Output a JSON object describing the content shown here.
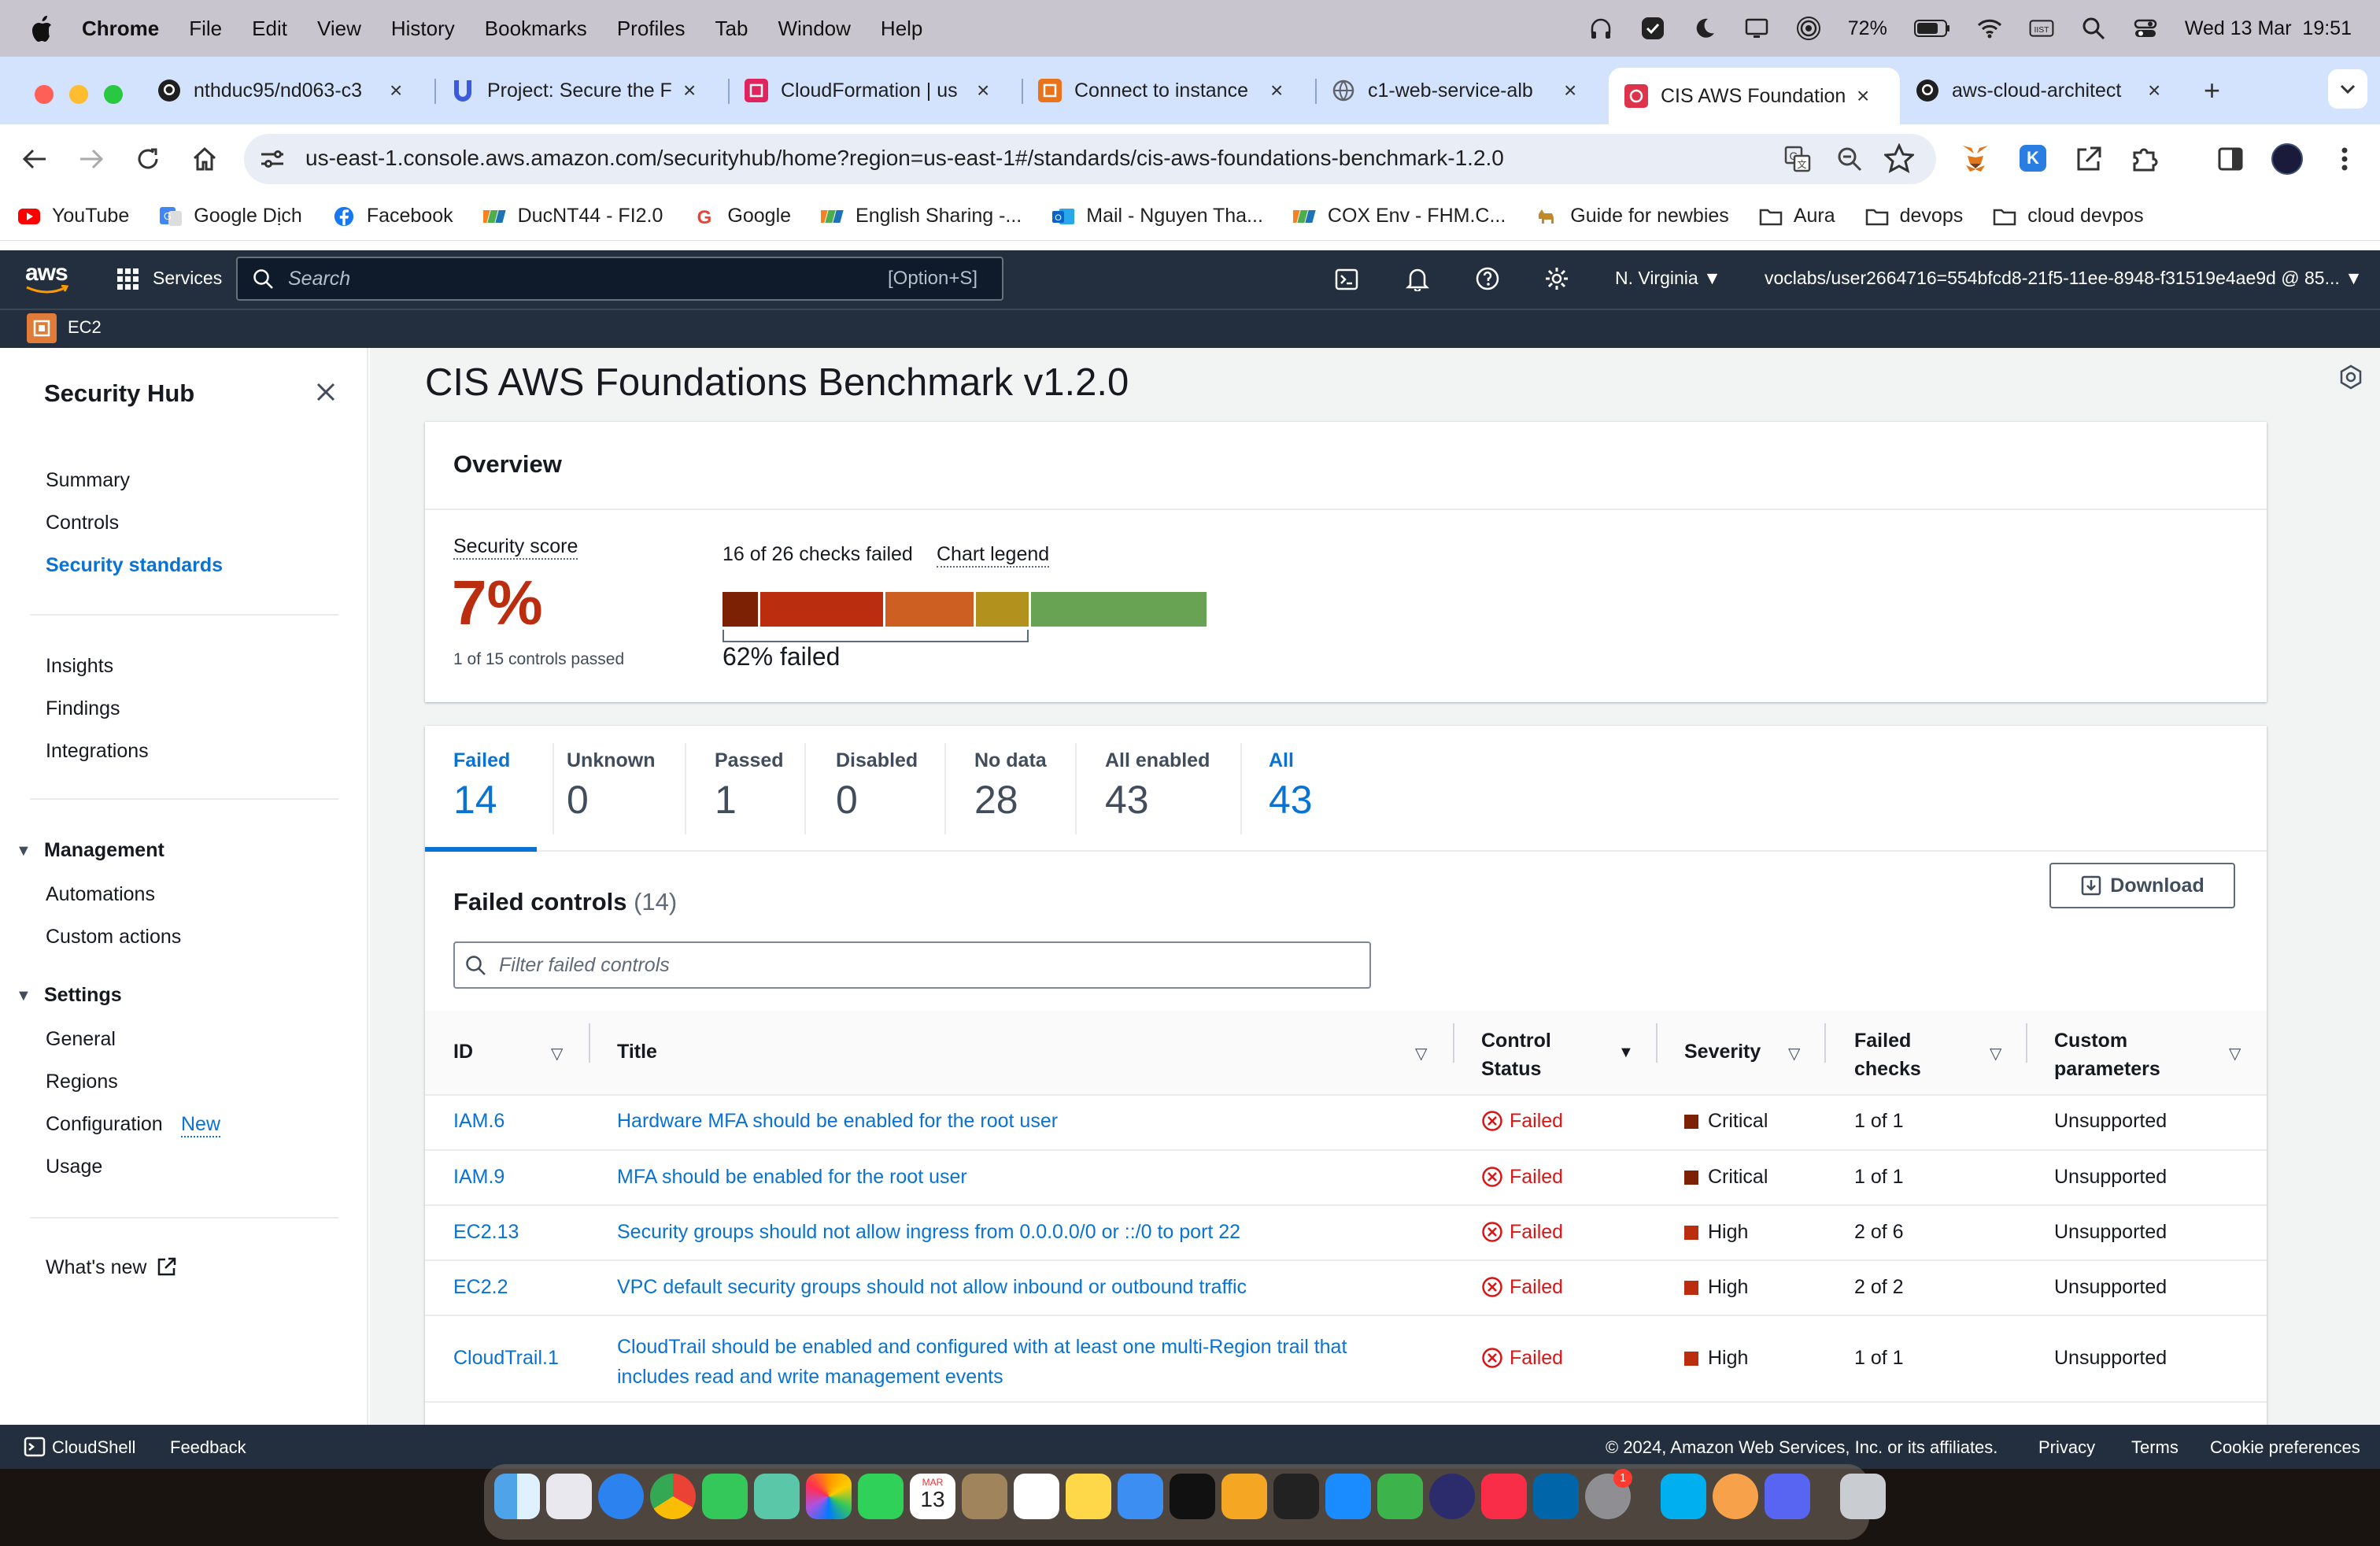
{
  "menubar": {
    "app": "Chrome",
    "items": [
      "File",
      "Edit",
      "View",
      "History",
      "Bookmarks",
      "Profiles",
      "Tab",
      "Window",
      "Help"
    ],
    "battery": "72%",
    "datetime": "Wed 13 Mar  19:51"
  },
  "tabs": [
    {
      "title": "nthduc95/nd063-c3",
      "fav_color": "#1f1f1f"
    },
    {
      "title": "Project: Secure the F",
      "fav_color": "#3b5bdb"
    },
    {
      "title": "CloudFormation | us",
      "fav_color": "#e0245e"
    },
    {
      "title": "Connect to instance",
      "fav_color": "#e8731a"
    },
    {
      "title": "c1-web-service-alb",
      "fav_color": "#5f6368"
    },
    {
      "title": "CIS AWS Foundation",
      "fav_color": "#dd344c"
    },
    {
      "title": "aws-cloud-architect",
      "fav_color": "#1f1f1f"
    }
  ],
  "address": {
    "url": "us-east-1.console.aws.amazon.com/securityhub/home?region=us-east-1#/standards/cis-aws-foundations-benchmark-1.2.0"
  },
  "bookmarks": [
    {
      "label": "YouTube",
      "color": "#ff0000"
    },
    {
      "label": "Google Dịch",
      "color": "#4285f4"
    },
    {
      "label": "Facebook",
      "color": "#1877f2"
    },
    {
      "label": "DucNT44 - FI2.0",
      "color": "#f58220"
    },
    {
      "label": "Google",
      "color": "#ea4335"
    },
    {
      "label": "English Sharing -...",
      "color": "#f58220"
    },
    {
      "label": "Mail - Nguyen Tha...",
      "color": "#0a64c8"
    },
    {
      "label": "COX Env - FHM.C...",
      "color": "#f58220"
    },
    {
      "label": "Guide for newbies",
      "color": "#c08a2c"
    },
    {
      "label": "Aura",
      "color": "folder"
    },
    {
      "label": "devops",
      "color": "folder"
    },
    {
      "label": "cloud devpos",
      "color": "folder"
    }
  ],
  "aws": {
    "logo": "aws",
    "services": "Services",
    "search_placeholder": "Search",
    "search_shortcut": "[Option+S]",
    "region": "N. Virginia",
    "account": "voclabs/user2664716=554bfcd8-21f5-11ee-8948-f31519e4ae9d @ 85...",
    "favorite": "EC2"
  },
  "sidebar": {
    "title": "Security Hub",
    "group1": [
      "Summary",
      "Controls",
      "Security standards"
    ],
    "group2": [
      "Insights",
      "Findings",
      "Integrations"
    ],
    "management": {
      "header": "Management",
      "items": [
        "Automations",
        "Custom actions"
      ]
    },
    "settings": {
      "header": "Settings",
      "items": [
        "General",
        "Regions",
        "Configuration",
        "Usage"
      ],
      "new_badge": "New"
    },
    "whats_new": "What's new"
  },
  "page": {
    "title": "CIS AWS Foundations Benchmark v1.2.0",
    "overview": {
      "header": "Overview",
      "score_label": "Security score",
      "score": "7%",
      "score_sub": "1 of 15 controls passed",
      "checks_failed": "16 of 26 checks failed",
      "chart_legend": "Chart legend",
      "failed_pct": "62% failed",
      "bar_segments": [
        {
          "severity": "critical",
          "share": 2,
          "color": "#7d2105"
        },
        {
          "severity": "high",
          "share": 7,
          "color": "#ba2e0f"
        },
        {
          "severity": "medium",
          "share": 5,
          "color": "#cc5f21"
        },
        {
          "severity": "low",
          "share": 3,
          "color": "#b2911c"
        },
        {
          "severity": "passed",
          "share": 10,
          "color": "#67a353"
        }
      ]
    },
    "filter_tabs": [
      {
        "label": "Failed",
        "count": "14"
      },
      {
        "label": "Unknown",
        "count": "0"
      },
      {
        "label": "Passed",
        "count": "1"
      },
      {
        "label": "Disabled",
        "count": "0"
      },
      {
        "label": "No data",
        "count": "28"
      },
      {
        "label": "All enabled",
        "count": "43"
      },
      {
        "label": "All",
        "count": "43"
      }
    ],
    "table": {
      "title": "Failed controls",
      "count": "(14)",
      "download": "Download",
      "filter_placeholder": "Filter failed controls",
      "columns": [
        "ID",
        "Title",
        "Control Status",
        "Severity",
        "Failed checks",
        "Custom parameters"
      ],
      "rows": [
        {
          "id": "IAM.6",
          "title": "Hardware MFA should be enabled for the root user",
          "status": "Failed",
          "severity": "Critical",
          "sev_color": "#7d2105",
          "checks": "1 of 1",
          "params": "Unsupported"
        },
        {
          "id": "IAM.9",
          "title": "MFA should be enabled for the root user",
          "status": "Failed",
          "severity": "Critical",
          "sev_color": "#7d2105",
          "checks": "1 of 1",
          "params": "Unsupported"
        },
        {
          "id": "EC2.13",
          "title": "Security groups should not allow ingress from 0.0.0.0/0 or ::/0 to port 22",
          "status": "Failed",
          "severity": "High",
          "sev_color": "#ba2e0f",
          "checks": "2 of 6",
          "params": "Unsupported"
        },
        {
          "id": "EC2.2",
          "title": "VPC default security groups should not allow inbound or outbound traffic",
          "status": "Failed",
          "severity": "High",
          "sev_color": "#ba2e0f",
          "checks": "2 of 2",
          "params": "Unsupported"
        },
        {
          "id": "CloudTrail.1",
          "title_line1": "CloudTrail should be enabled and configured with at least one multi-Region trail that",
          "title_line2": "includes read and write management events",
          "status": "Failed",
          "severity": "High",
          "sev_color": "#ba2e0f",
          "checks": "1 of 1",
          "params": "Unsupported"
        }
      ]
    }
  },
  "footer": {
    "cloudshell": "CloudShell",
    "feedback": "Feedback",
    "copyright": "© 2024, Amazon Web Services, Inc. or its affiliates.",
    "privacy": "Privacy",
    "terms": "Terms",
    "cookies": "Cookie preferences"
  },
  "dock": {
    "calendar_month": "MAR",
    "calendar_day": "13",
    "badge": "1"
  }
}
